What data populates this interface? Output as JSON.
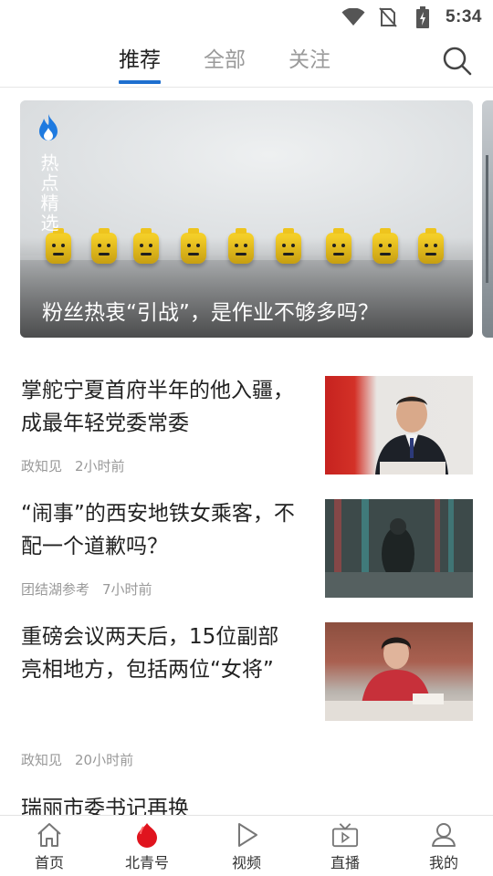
{
  "status_bar": {
    "time": "5:34",
    "icons": [
      "wifi-icon",
      "no-sim-icon",
      "battery-charging-icon"
    ]
  },
  "top_tabs": [
    {
      "label": "推荐",
      "active": true
    },
    {
      "label": "全部",
      "active": false
    },
    {
      "label": "关注",
      "active": false
    }
  ],
  "search_icon": "search-icon",
  "hero": {
    "badge_icon": "flame-icon",
    "badge_label": "热点精选",
    "title": "粉丝热衷“引战”，是作业不够多吗？"
  },
  "news": [
    {
      "title": "掌舵宁夏首府半年的他入疆，成最年轻党委常委",
      "source": "政知见",
      "time": "2小时前"
    },
    {
      "title": "“闹事”的西安地铁女乘客，不配一个道歉吗？",
      "source": "团结湖参考",
      "time": "7小时前"
    },
    {
      "title": "重磅会议两天后，15位副部亮相地方，包括两位“女将”",
      "source": "政知见",
      "time": "20小时前"
    },
    {
      "title": "瑞丽市委书记再换"
    }
  ],
  "bottom_nav": [
    {
      "label": "首页",
      "icon": "home-icon"
    },
    {
      "label": "北青号",
      "icon": "beiqing-logo-icon"
    },
    {
      "label": "视频",
      "icon": "play-icon"
    },
    {
      "label": "直播",
      "icon": "tv-icon"
    },
    {
      "label": "我的",
      "icon": "user-icon"
    }
  ],
  "colors": {
    "accent": "#1e6fcf",
    "brand_red": "#e0141e",
    "meta_gray": "#999999"
  }
}
